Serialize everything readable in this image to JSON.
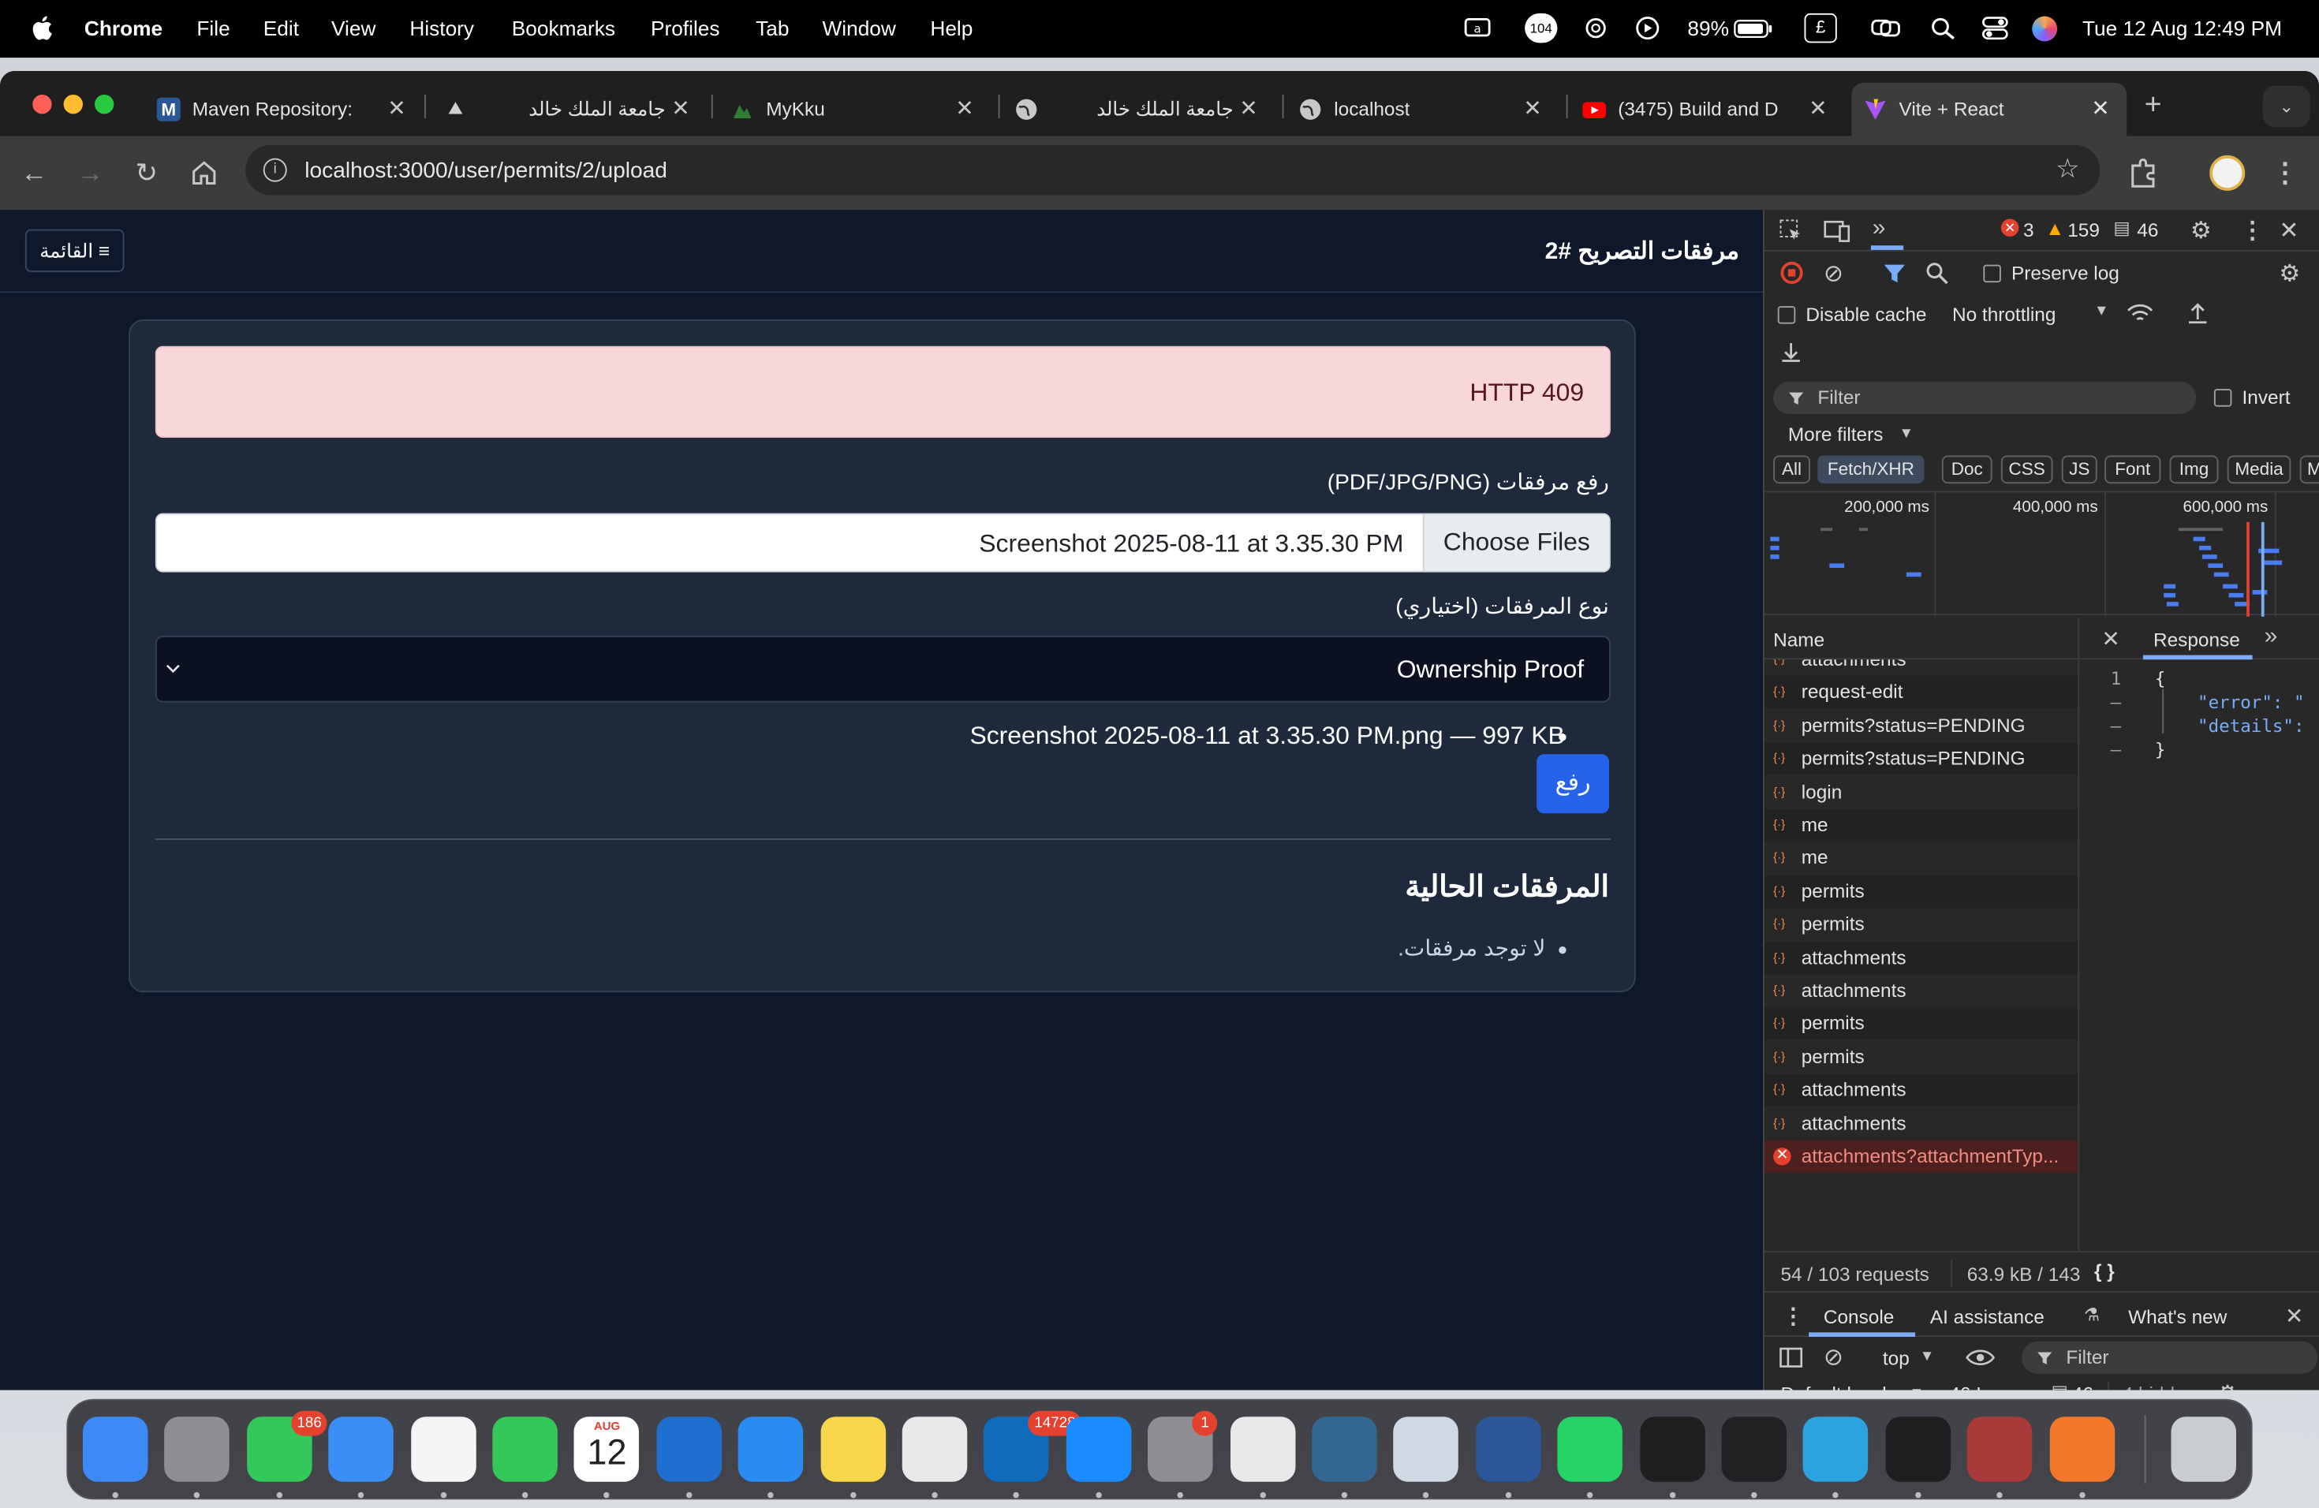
{
  "menubar": {
    "app": "Chrome",
    "items": [
      "File",
      "Edit",
      "View",
      "History",
      "Bookmarks",
      "Profiles",
      "Tab",
      "Window",
      "Help"
    ],
    "status_badge": "104",
    "battery": "89%",
    "input_indicator": "£",
    "datetime": "Tue 12 Aug  12:49 PM"
  },
  "browser": {
    "tabs": [
      {
        "label": "Maven Repository:",
        "favicon": "maven-icon",
        "color": "#2b5797"
      },
      {
        "label": "جامعة الملك خالد",
        "favicon": "kku-icon",
        "color": "#d0d0d0"
      },
      {
        "label": "MyKku",
        "favicon": "mykku-icon",
        "color": "#2e7d32"
      },
      {
        "label": "جامعة الملك خالد",
        "favicon": "globe-icon",
        "color": "#c7c7c7"
      },
      {
        "label": "localhost",
        "favicon": "globe-icon",
        "color": "#c7c7c7"
      },
      {
        "label": "(3475) Build and D",
        "favicon": "youtube-icon",
        "color": "#ff0000"
      },
      {
        "label": "Vite + React",
        "favicon": "vite-icon",
        "color": "#a855f7"
      }
    ],
    "url": "localhost:3000/user/permits/2/upload"
  },
  "app": {
    "title": "مرفقات التصريح #2",
    "menu_label": "≡ القائمة",
    "error": "HTTP 409",
    "upload_label": "رفع مرفقات (PDF/JPG/PNG)",
    "file_input": {
      "selected": "Screenshot 2025-08-11 at 3.35.30 PM",
      "button": "Choose Files"
    },
    "type_label": "نوع المرفقات (اختياري)",
    "type_value": "Ownership Proof",
    "selected_file": "Screenshot 2025-08-11 at 3.35.30 PM.png — 997 KB",
    "upload_button": "رفع",
    "current_heading": "المرفقات الحالية",
    "no_attachments": "لا توجد مرفقات."
  },
  "devtools": {
    "errors": "3",
    "warnings": "159",
    "messages": "46",
    "preserve_log": "Preserve log",
    "disable_cache": "Disable cache",
    "throttling": "No throttling",
    "filter_placeholder": "Filter",
    "invert": "Invert",
    "more_filters": "More filters",
    "type_filters": [
      "All",
      "Fetch/XHR",
      "Doc",
      "CSS",
      "JS",
      "Font",
      "Img",
      "Media",
      "M"
    ],
    "active_filter": "Fetch/XHR",
    "timeline_ticks": [
      "200,000 ms",
      "400,000 ms",
      "600,000 ms"
    ],
    "name_header": "Name",
    "response_tab": "Response",
    "requests": [
      {
        "name": "attachments",
        "status": "ok"
      },
      {
        "name": "request-edit",
        "status": "ok"
      },
      {
        "name": "permits?status=PENDING",
        "status": "ok"
      },
      {
        "name": "permits?status=PENDING",
        "status": "ok"
      },
      {
        "name": "login",
        "status": "ok"
      },
      {
        "name": "me",
        "status": "ok"
      },
      {
        "name": "me",
        "status": "ok"
      },
      {
        "name": "permits",
        "status": "ok"
      },
      {
        "name": "permits",
        "status": "ok"
      },
      {
        "name": "attachments",
        "status": "ok"
      },
      {
        "name": "attachments",
        "status": "ok"
      },
      {
        "name": "permits",
        "status": "ok"
      },
      {
        "name": "permits",
        "status": "ok"
      },
      {
        "name": "attachments",
        "status": "ok"
      },
      {
        "name": "attachments",
        "status": "ok"
      },
      {
        "name": "attachments?attachmentTyp...",
        "status": "error"
      }
    ],
    "response_lines": [
      {
        "num": "1",
        "text": "{"
      },
      {
        "num": "–",
        "text": "    \"error\": \""
      },
      {
        "num": "–",
        "text": "    \"details\":"
      },
      {
        "num": "–",
        "text": "}"
      }
    ],
    "summary": {
      "requests": "54 / 103 requests",
      "size": "63.9 kB / 143"
    },
    "drawer": {
      "tabs": [
        "Console",
        "AI assistance",
        "What's new"
      ],
      "context": "top",
      "filter": "Filter",
      "levels": "Default levels",
      "issues_label": "46 Issues:",
      "issues_count": "46",
      "hidden": "4 hidden"
    }
  },
  "dock": {
    "apps": [
      {
        "name": "finder",
        "color": "#3d8af7"
      },
      {
        "name": "launchpad",
        "color": "#8e8e93"
      },
      {
        "name": "messages",
        "color": "#34c759",
        "badge": "186"
      },
      {
        "name": "mail",
        "color": "#3a8ef6"
      },
      {
        "name": "photos",
        "color": "#f5f5f5"
      },
      {
        "name": "facetime",
        "color": "#34c759"
      },
      {
        "name": "calendar",
        "color": "#ffffff",
        "month": "AUG",
        "day": "12"
      },
      {
        "name": "vscode",
        "color": "#1f6fd0"
      },
      {
        "name": "safari",
        "color": "#2a8cf0"
      },
      {
        "name": "notes",
        "color": "#f7d649"
      },
      {
        "name": "chrome",
        "color": "#e8e8e8"
      },
      {
        "name": "outlook",
        "color": "#0f6cbd",
        "badge": "14728"
      },
      {
        "name": "app-store",
        "color": "#1a8cff"
      },
      {
        "name": "system-settings",
        "color": "#8e8e93",
        "badge": "1"
      },
      {
        "name": "iphone-mirroring",
        "color": "#e8e8e8"
      },
      {
        "name": "postgres",
        "color": "#336791"
      },
      {
        "name": "preview",
        "color": "#cfd8e3"
      },
      {
        "name": "word",
        "color": "#2b579a"
      },
      {
        "name": "whatsapp",
        "color": "#25d366"
      },
      {
        "name": "intellij",
        "color": "#1e1e1e"
      },
      {
        "name": "chatgpt",
        "color": "#202123"
      },
      {
        "name": "telegram",
        "color": "#2aa3e0"
      },
      {
        "name": "terminal",
        "color": "#1e1e1e"
      },
      {
        "name": "dictionary",
        "color": "#a83a3a"
      },
      {
        "name": "pencil-app",
        "color": "#f2782b"
      },
      {
        "name": "trash",
        "color": "#c9ccd1"
      }
    ]
  }
}
